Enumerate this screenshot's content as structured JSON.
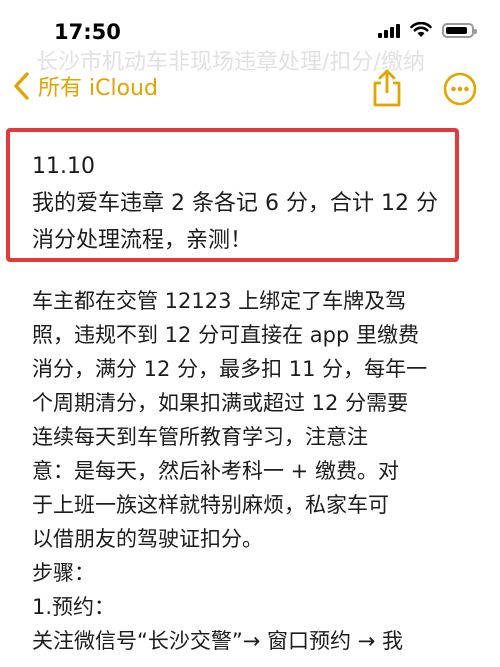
{
  "status_bar": {
    "time": "17:50"
  },
  "ghost_title": "长沙市机动车非现场违章处理/扣分/缴纳",
  "nav": {
    "back_label": "所有 iCloud",
    "accent_color": "#e3a400",
    "share_icon": "share-icon",
    "more_icon": "ellipsis-circle-icon"
  },
  "highlight": {
    "border_color": "#e23a3a",
    "lines": [
      "11.10",
      "我的爱车违章 2 条各记 6 分，合计 12 分",
      "消分处理流程，亲测！"
    ]
  },
  "body": {
    "lines": [
      "车主都在交管 12123 上绑定了车牌及驾",
      "照，违规不到 12 分可直接在 app 里缴费",
      "消分，满分 12 分，最多扣 11 分，每年一",
      "个周期清分，如果扣满或超过 12 分需要",
      "连续每天到车管所教育学习，注意注",
      "意：是每天，然后补考科一 + 缴费。对",
      "于上班一族这样就特别麻烦，私家车可",
      "以借朋友的驾驶证扣分。",
      "步骤：",
      "1.预约：",
      "关注微信号“长沙交警”→ 窗口预约 → 我"
    ]
  }
}
